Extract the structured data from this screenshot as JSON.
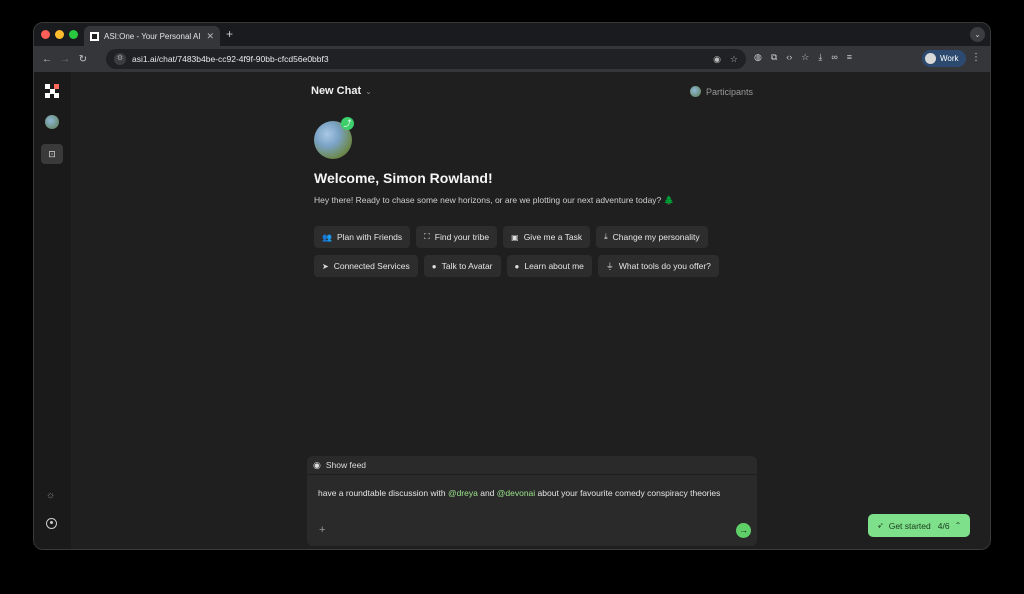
{
  "browser": {
    "tab_title": "ASI:One - Your Personal AI",
    "tab_close": "✕",
    "new_tab": "+",
    "url": "asi1.ai/chat/7483b4be-cc92-4f9f-90bb-cfcd56e0bbf3",
    "profile_label": "Work"
  },
  "chat": {
    "title": "New Chat",
    "participants_label": "Participants",
    "welcome": "Welcome, Simon Rowland!",
    "subtitle": "Hey there! Ready to chase some new horizons, or are we plotting our next adventure today? 🌲"
  },
  "suggestions": {
    "row1": [
      {
        "label": "Plan with Friends",
        "icon": "users-icon"
      },
      {
        "label": "Find your tribe",
        "icon": "scan-icon"
      },
      {
        "label": "Give me a Task",
        "icon": "clipboard-icon"
      },
      {
        "label": "Change my personality",
        "icon": "download-icon"
      }
    ],
    "row2": [
      {
        "label": "Connected Services",
        "icon": "send-icon"
      },
      {
        "label": "Talk to Avatar",
        "icon": "person-icon"
      },
      {
        "label": "Learn about me",
        "icon": "lightbulb-icon"
      },
      {
        "label": "What tools do you offer?",
        "icon": "plug-icon"
      }
    ]
  },
  "composer": {
    "show_feed_label": "Show feed",
    "text_prefix": "have a roundtable discussion with ",
    "mention1": "@dreya",
    "text_mid": " and ",
    "mention2": "@devonai",
    "text_suffix": " about your favourite comedy conspiracy theories"
  },
  "onboarding": {
    "label": "Get started",
    "progress": "4/6"
  },
  "colors": {
    "accent": "#7ee08a",
    "send": "#5fd068",
    "mention": "#9be38a"
  }
}
